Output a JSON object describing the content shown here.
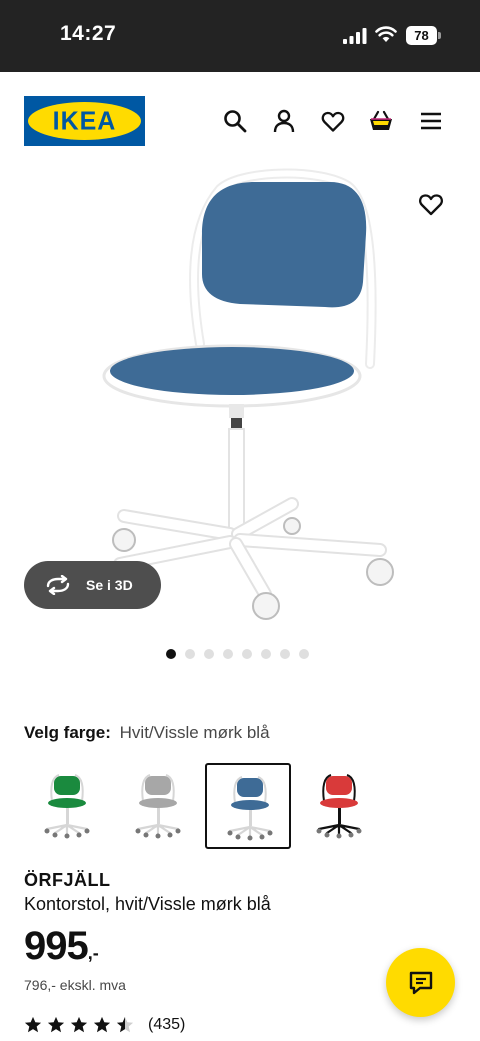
{
  "status_bar": {
    "time": "14:27",
    "battery_level": "78",
    "icons": [
      "signal-icon",
      "wifi-icon",
      "battery-icon"
    ]
  },
  "header": {
    "logo_text": "IKEA",
    "icons": [
      "search-icon",
      "account-icon",
      "heart-icon",
      "basket-icon",
      "menu-icon"
    ]
  },
  "gallery": {
    "view_3d_label": "Se i 3D",
    "dot_count": 8,
    "active_dot": 1
  },
  "color_picker": {
    "label": "Velg farge:",
    "selected_value": "Hvit/Vissle mørk blå",
    "swatches": [
      {
        "seat_color": "#1a8a3e",
        "frame_color": "#ffffff",
        "selected": false
      },
      {
        "seat_color": "#a7a7a7",
        "frame_color": "#ffffff",
        "selected": false
      },
      {
        "seat_color": "#3e6b96",
        "frame_color": "#ffffff",
        "selected": true
      },
      {
        "seat_color": "#d93a3a",
        "frame_color": "#111111",
        "selected": false
      }
    ]
  },
  "product": {
    "name": "ÖRFJÄLL",
    "description": "Kontorstol, hvit/Vissle mørk blå",
    "price": "995",
    "price_suffix": ",-",
    "price_ex_vat": "796,- ekskl. mva",
    "rating": 4.5,
    "review_count": "(435)"
  },
  "colors": {
    "ikea_blue": "#0058a3",
    "ikea_yellow": "#ffdb00",
    "seat_blue": "#3e6b96",
    "status_bar_bg": "#232323",
    "button_3d_bg": "#4e4e4e"
  }
}
